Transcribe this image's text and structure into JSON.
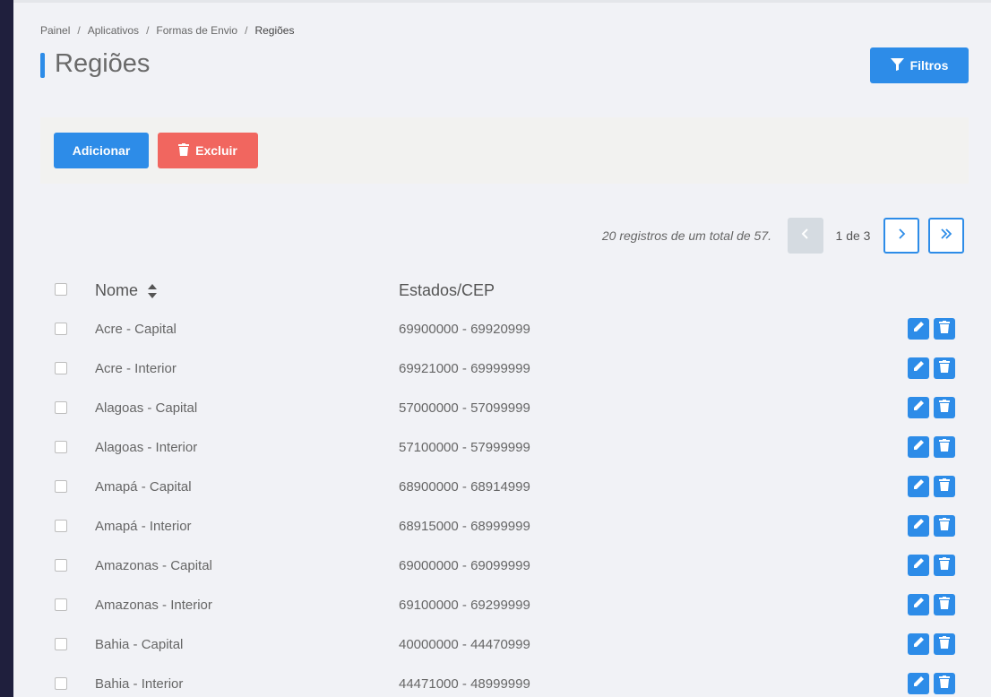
{
  "breadcrumb": {
    "items": [
      "Painel",
      "Aplicativos",
      "Formas de Envio"
    ],
    "separator": "/",
    "current": "Regiões"
  },
  "page": {
    "title": "Regiões"
  },
  "toolbar": {
    "filter_label": "Filtros",
    "add_label": "Adicionar",
    "delete_label": "Excluir"
  },
  "pagination": {
    "info": "20 registros de um total de 57.",
    "page_label": "1 de 3",
    "current_page": 1,
    "total_pages": 3
  },
  "table": {
    "headers": {
      "name": "Nome",
      "states": "Estados/CEP"
    },
    "rows": [
      {
        "name": "Acre - Capital",
        "cep": "69900000 - 69920999"
      },
      {
        "name": "Acre - Interior",
        "cep": "69921000 - 69999999"
      },
      {
        "name": "Alagoas - Capital",
        "cep": "57000000 - 57099999"
      },
      {
        "name": "Alagoas - Interior",
        "cep": "57100000 - 57999999"
      },
      {
        "name": "Amapá - Capital",
        "cep": "68900000 - 68914999"
      },
      {
        "name": "Amapá - Interior",
        "cep": "68915000 - 68999999"
      },
      {
        "name": "Amazonas - Capital",
        "cep": "69000000 - 69099999"
      },
      {
        "name": "Amazonas - Interior",
        "cep": "69100000 - 69299999"
      },
      {
        "name": "Bahia - Capital",
        "cep": "40000000 - 44470999"
      },
      {
        "name": "Bahia - Interior",
        "cep": "44471000 - 48999999"
      }
    ]
  },
  "icons": {
    "filter": "filter-icon",
    "trash": "trash-icon",
    "edit": "pencil-icon",
    "sort": "sort-icon",
    "prev": "chevron-left-icon",
    "next": "chevron-right-icon",
    "last": "double-chevron-right-icon"
  },
  "colors": {
    "primary": "#2d8ce8",
    "danger": "#f1665f",
    "sidebar": "#1f1f3d",
    "background": "#f1f2f6"
  }
}
